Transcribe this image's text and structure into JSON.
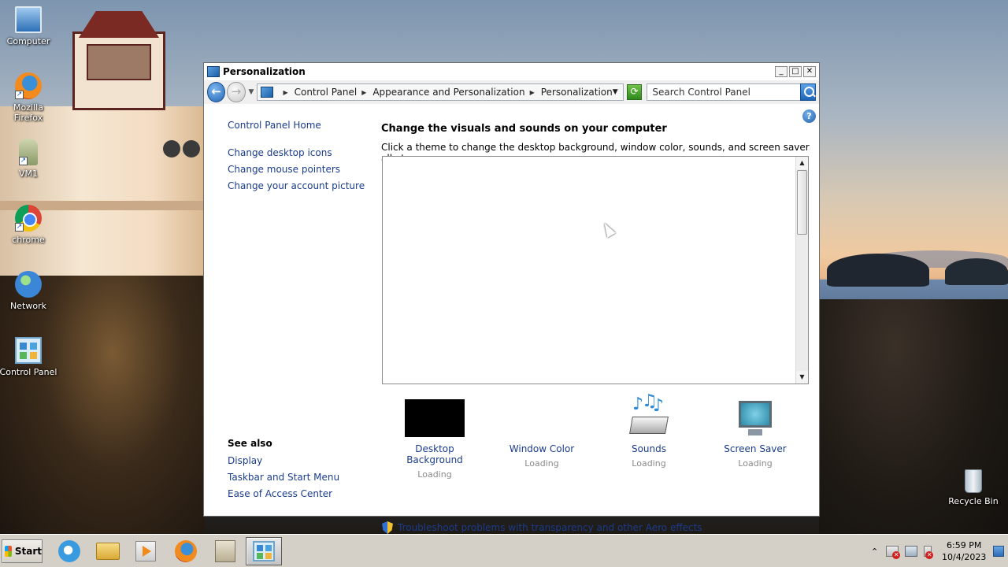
{
  "desktop": {
    "icons": [
      {
        "label": "Computer",
        "icon": "computer-icon"
      },
      {
        "label": "Mozilla Firefox",
        "icon": "firefox-icon"
      },
      {
        "label": "VM1",
        "icon": "user-folder-icon"
      },
      {
        "label": "chrome",
        "icon": "chrome-icon"
      },
      {
        "label": "Network",
        "icon": "network-icon"
      },
      {
        "label": "Control Panel",
        "icon": "control-panel-icon"
      },
      {
        "label": "Recycle Bin",
        "icon": "recycle-bin-icon"
      }
    ]
  },
  "window": {
    "title": "Personalization",
    "controls": {
      "minimize": "_",
      "maximize": "□",
      "close": "✕"
    },
    "address": {
      "breadcrumb": [
        "Control Panel",
        "Appearance and Personalization",
        "Personalization"
      ],
      "search_placeholder": "Search Control Panel"
    },
    "left_pane": {
      "home_link": "Control Panel Home",
      "links": [
        "Change desktop icons",
        "Change mouse pointers",
        "Change your account picture"
      ],
      "see_also_heading": "See also",
      "see_also_links": [
        "Display",
        "Taskbar and Start Menu",
        "Ease of Access Center"
      ]
    },
    "main": {
      "heading": "Change the visuals and sounds on your computer",
      "description": "Click a theme to change the desktop background, window color, sounds, and screen saver all at once.",
      "help_glyph": "?",
      "settings": [
        {
          "label": "Desktop Background",
          "status": "Loading"
        },
        {
          "label": "Window Color",
          "status": "Loading"
        },
        {
          "label": "Sounds",
          "status": "Loading"
        },
        {
          "label": "Screen Saver",
          "status": "Loading"
        }
      ],
      "troubleshoot_link": "Troubleshoot problems with transparency and other Aero effects"
    }
  },
  "taskbar": {
    "start_label": "Start",
    "apps": [
      "internet-explorer-icon",
      "folder-icon",
      "media-player-icon",
      "firefox-icon",
      "archive-icon",
      "control-panel-icon"
    ],
    "active_app": "control-panel-icon",
    "clock": {
      "time": "6:59 PM",
      "date": "10/4/2023"
    }
  }
}
